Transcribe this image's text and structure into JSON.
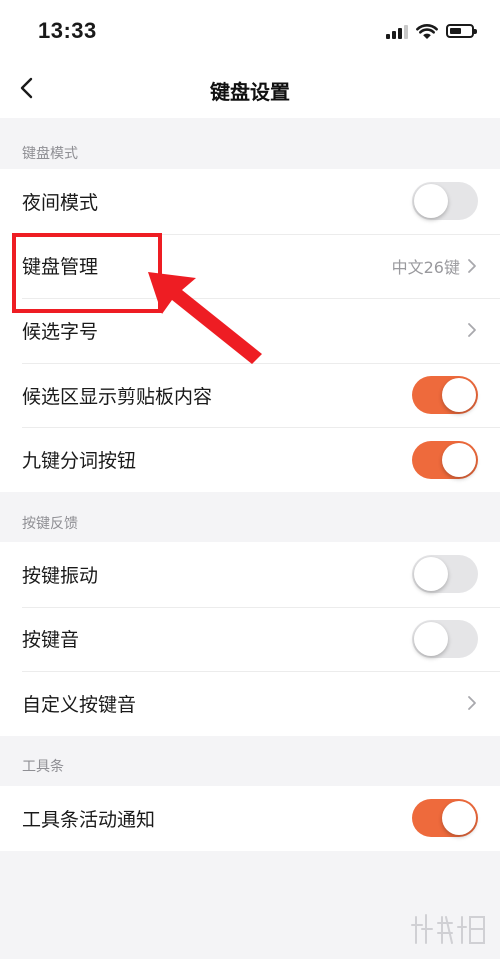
{
  "status_bar": {
    "time": "13:33",
    "icons": [
      "signal-icon",
      "wifi-icon",
      "battery-icon"
    ]
  },
  "nav": {
    "title": "键盘设置",
    "back_icon": "chevron-left-icon"
  },
  "sections": [
    {
      "header": "键盘模式",
      "rows": [
        {
          "label": "夜间模式",
          "control": "toggle",
          "on": false
        },
        {
          "label": "键盘管理",
          "control": "link",
          "value": "中文26键"
        },
        {
          "label": "候选字号",
          "control": "link"
        },
        {
          "label": "候选区显示剪贴板内容",
          "control": "toggle",
          "on": true
        },
        {
          "label": "九键分词按钮",
          "control": "toggle",
          "on": true
        }
      ]
    },
    {
      "header": "按键反馈",
      "rows": [
        {
          "label": "按键振动",
          "control": "toggle",
          "on": false
        },
        {
          "label": "按键音",
          "control": "toggle",
          "on": false
        },
        {
          "label": "自定义按键音",
          "control": "link"
        }
      ]
    },
    {
      "header": "工具条",
      "rows": [
        {
          "label": "工具条活动通知",
          "control": "toggle",
          "on": true
        }
      ]
    }
  ],
  "colors": {
    "accent_orange": "#ee6a3c",
    "toggle_off": "#e5e5e7",
    "annotation_red": "#ee1d23",
    "background": "#f4f4f6"
  },
  "annotation": {
    "highlight": "highlight-box",
    "arrow": "red-arrow-icon"
  }
}
